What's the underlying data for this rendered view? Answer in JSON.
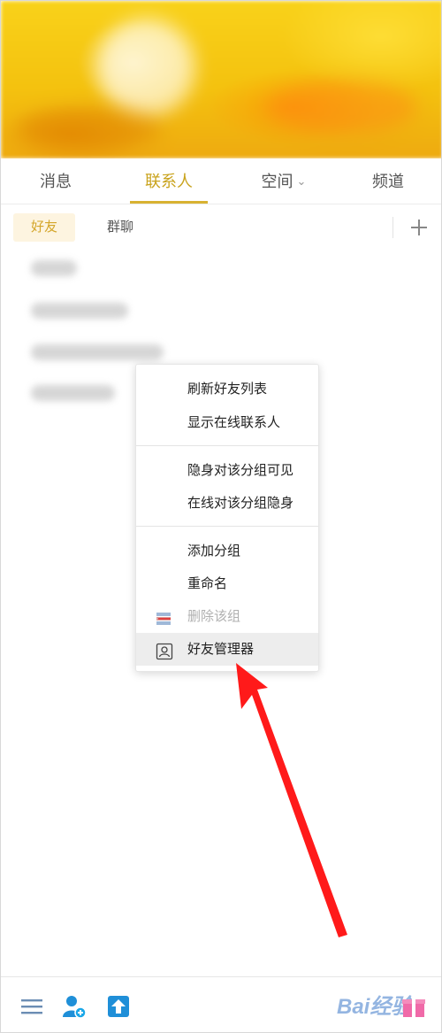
{
  "tabs": [
    {
      "label": "消息"
    },
    {
      "label": "联系人"
    },
    {
      "label": "空间"
    },
    {
      "label": "频道"
    }
  ],
  "active_tab": "联系人",
  "subtabs": [
    {
      "label": "好友"
    },
    {
      "label": "群聊"
    }
  ],
  "active_subtab": "好友",
  "context_menu": {
    "items": [
      {
        "label": "刷新好友列表"
      },
      {
        "label": "显示在线联系人"
      },
      {
        "label": "隐身对该分组可见"
      },
      {
        "label": "在线对该分组隐身"
      },
      {
        "label": "添加分组"
      },
      {
        "label": "重命名"
      },
      {
        "label": "删除该组",
        "disabled": true
      },
      {
        "label": "好友管理器",
        "hovered": true
      }
    ]
  },
  "toolbar": {
    "icons": [
      "menu-icon",
      "add-friend-icon",
      "upload-icon",
      "gift-icon"
    ]
  },
  "watermark_text": "Bai经验",
  "colors": {
    "accent": "#c9a31d",
    "banner": "#f4c20f",
    "arrow": "#ff1a1a"
  }
}
